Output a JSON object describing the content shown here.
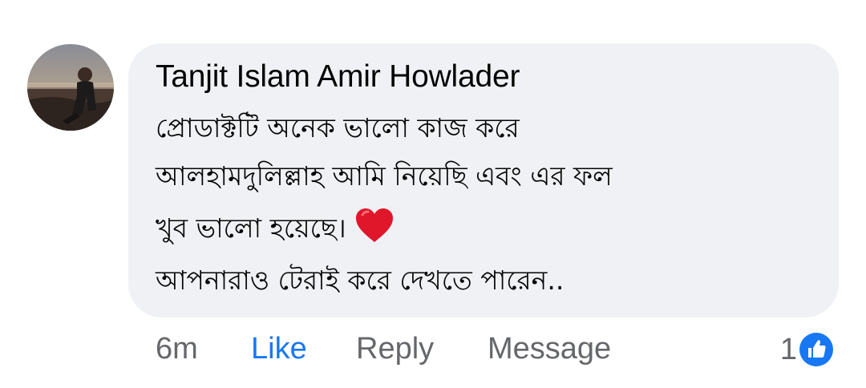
{
  "comment": {
    "author": "Tanjit Islam Amir Howlader",
    "lines": [
      "প্রোডাক্টটি অনেক ভালো কাজ করে",
      "আলহামদুলিল্লাহ আমি নিয়েছি এবং এর ফল",
      "খুব ভালো হয়েছে।",
      "আপনারাও টেরাই করে দেখতে পারেন.."
    ],
    "emoji": "heart-emoji"
  },
  "actions": {
    "time": "6m",
    "like": "Like",
    "reply": "Reply",
    "message": "Message"
  },
  "reactions": {
    "count": "1",
    "icon": "thumbs-up-icon"
  },
  "colors": {
    "bubble": "#eff1f4",
    "accent": "#1877f2",
    "muted": "#65676b",
    "heart": "#e0162b"
  }
}
